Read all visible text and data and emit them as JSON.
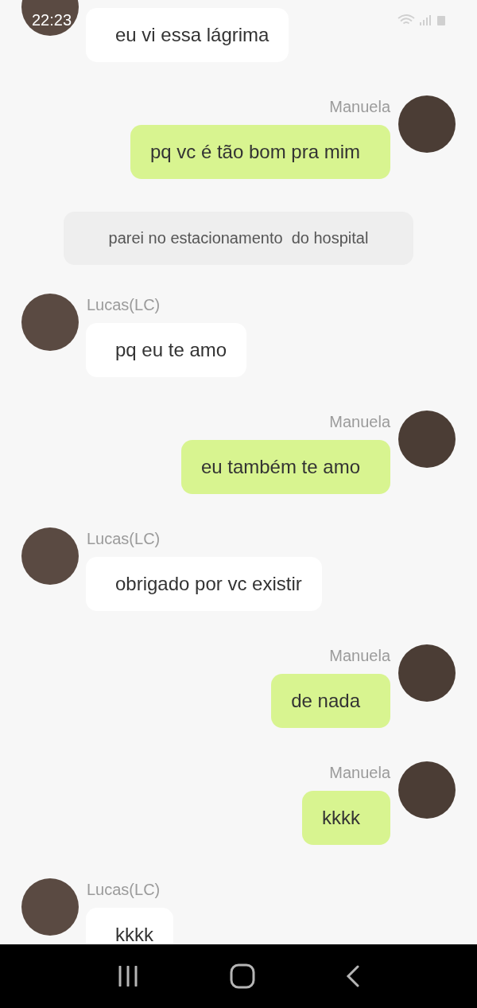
{
  "status_bar": {
    "time": "22:23"
  },
  "messages": [
    {
      "kind": "incoming",
      "text": "eu vi essa lágrima"
    },
    {
      "kind": "outgoing",
      "sender": "Manuela",
      "text": "pq vc é tão bom pra mim"
    },
    {
      "kind": "system",
      "text": "parei no estacionamento  do hospital"
    },
    {
      "kind": "incoming",
      "sender": "Lucas(LC)",
      "text": "pq eu te amo"
    },
    {
      "kind": "outgoing",
      "sender": "Manuela",
      "text": "eu também te amo"
    },
    {
      "kind": "incoming",
      "sender": "Lucas(LC)",
      "text": "obrigado por vc existir"
    },
    {
      "kind": "outgoing",
      "sender": "Manuela",
      "text": "de nada"
    },
    {
      "kind": "outgoing",
      "sender": "Manuela",
      "text": "kkkk"
    },
    {
      "kind": "incoming",
      "sender": "Lucas(LC)",
      "text": "kkkk"
    }
  ]
}
